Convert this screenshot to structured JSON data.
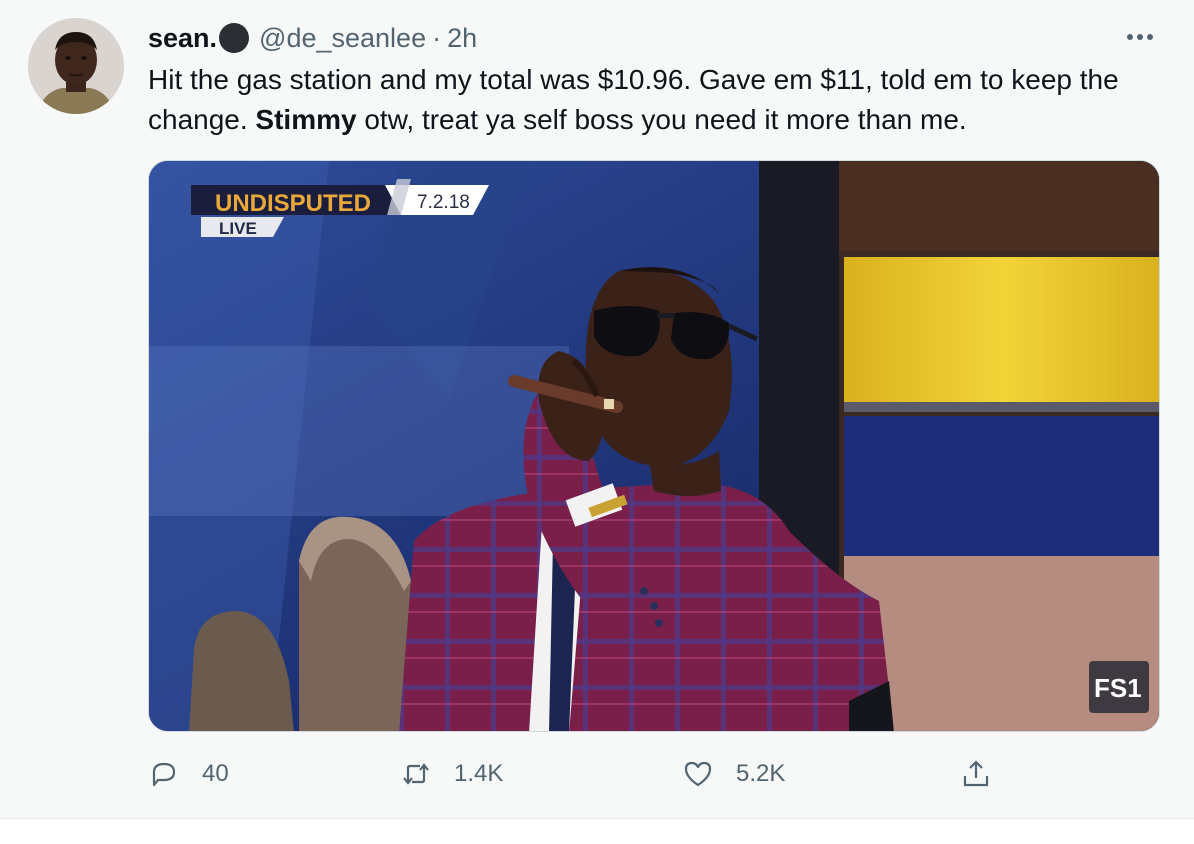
{
  "tweet": {
    "author_name": "sean.",
    "handle": "@de_seanlee",
    "separator": "·",
    "time": "2h",
    "text_part1": "Hit the gas station and my total was $10.96. Gave em $11, told em to keep the change. ",
    "text_bold": "Stimmy",
    "text_part2": " otw, treat ya self boss you need it more than me."
  },
  "media": {
    "show_title": "UNDISPUTED",
    "live_label": "LIVE",
    "date": "7.2.18",
    "network": "FS1"
  },
  "actions": {
    "replies": "40",
    "retweets": "1.4K",
    "likes": "5.2K"
  },
  "icons": [
    "more-icon",
    "reply-icon",
    "retweet-icon",
    "like-icon",
    "share-icon"
  ],
  "colors": {
    "text": "#0f1419",
    "secondary": "#536471",
    "background": "#f7f9f9"
  }
}
